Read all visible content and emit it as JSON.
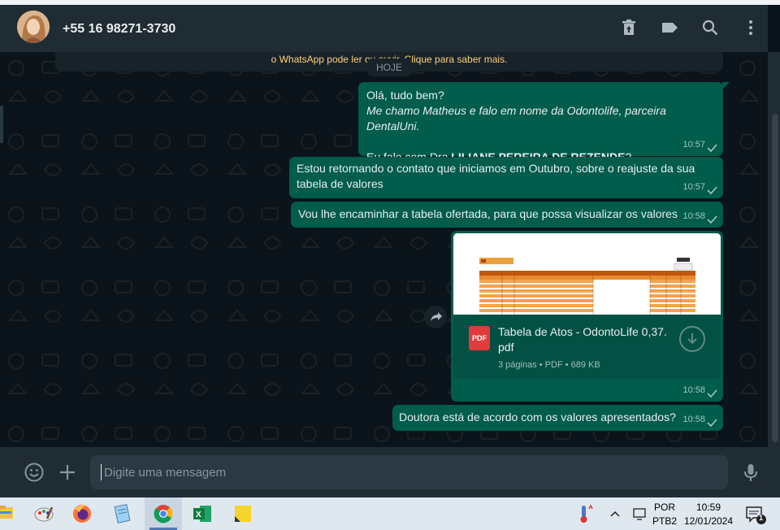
{
  "header": {
    "contact": "+55 16 98271-3730",
    "icons": [
      "archive-icon",
      "label-icon",
      "search-icon",
      "menu-icon"
    ]
  },
  "chat": {
    "encryption_notice": "o WhatsApp pode ler ou ouvir. Clique para saber mais.",
    "date_chip": "HOJE",
    "messages": [
      {
        "line1": "Olá, tudo bem?",
        "line2": "Me chamo Matheus e falo em nome da Odontolife, parceira DentalUni.",
        "line3_prefix": "Eu falo com Dra.",
        "line3_bold": "LILIANE PEREIRA DE REZENDE",
        "line3_suffix": "?",
        "time": "10:57"
      },
      {
        "text": "Estou retornando o contato que iniciamos em Outubro, sobre o reajuste da sua tabela de valores",
        "time": "10:57"
      },
      {
        "text": "Vou lhe encaminhar a tabela ofertada, para que possa visualizar os valores",
        "time": "10:58"
      },
      {
        "doc_name": "Tabela de Atos - OdontoLife 0,37. pdf",
        "doc_meta": "3 páginas • PDF • 689 KB",
        "pdf_label": "PDF",
        "time": "10:58"
      },
      {
        "text": "Doutora está de acordo com os valores apresentados?",
        "time": "10:58"
      }
    ]
  },
  "composer": {
    "placeholder": "Digite uma mensagem"
  },
  "taskbar": {
    "apps": [
      "file-explorer-icon",
      "paint-icon",
      "firefox-icon",
      "notepad-icon",
      "chrome-icon",
      "excel-icon",
      "sticky-notes-icon"
    ],
    "lang_top": "POR",
    "lang_bottom": "PTB2",
    "time": "10:59",
    "date": "12/01/2024",
    "notification_count": "1"
  },
  "colors": {
    "outgoing_bubble": "#005c4b",
    "header_bg": "#202c33",
    "chat_bg": "#0b141a",
    "encryption_text": "#ffd279"
  }
}
